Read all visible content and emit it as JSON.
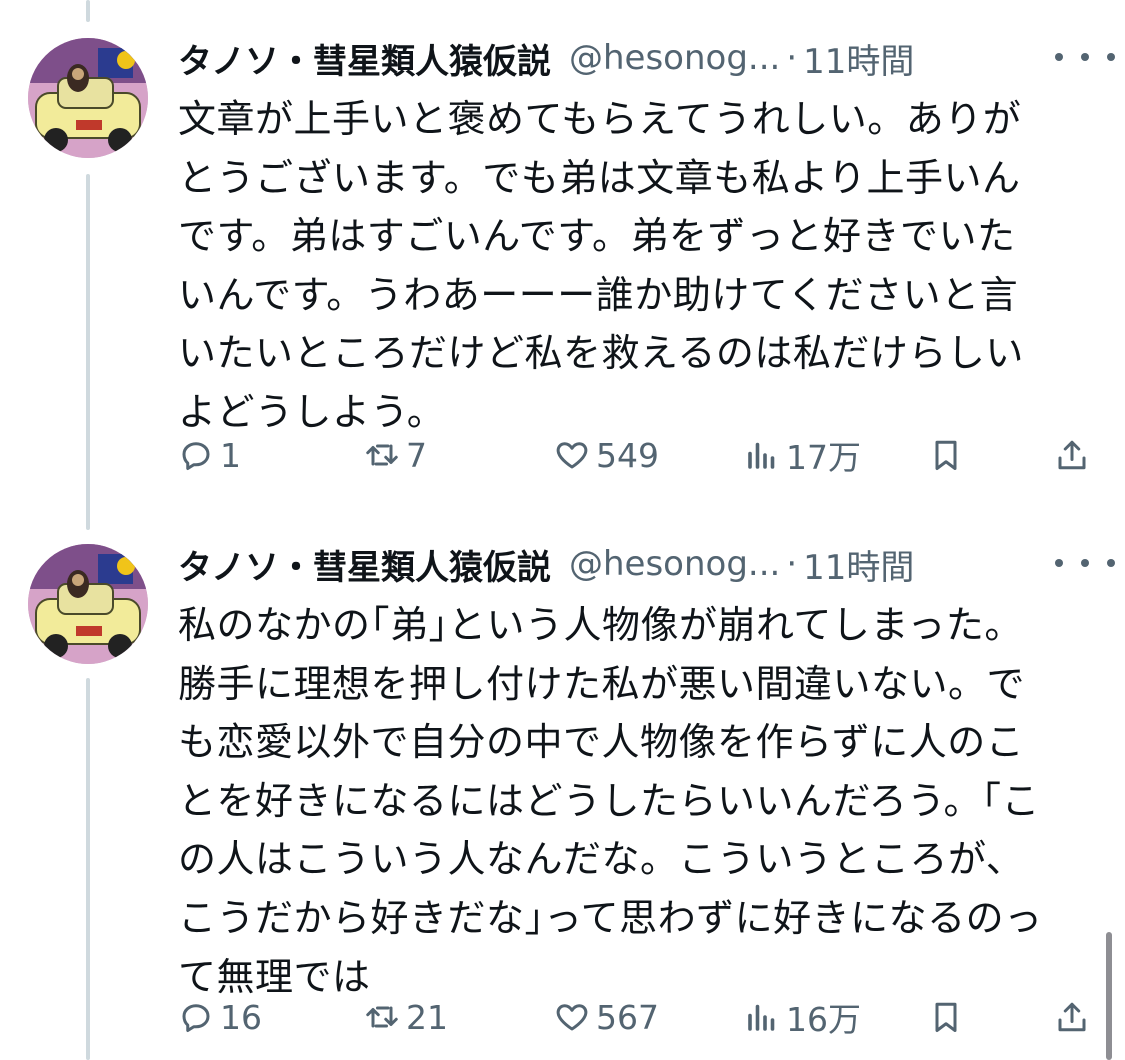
{
  "tweets": [
    {
      "name": "タノソ・彗星類人猿仮説",
      "handle": "@hesonog...",
      "separator": "·",
      "time": "11時間",
      "text": "文章が上手いと褒めてもらえてうれしい。ありが\nとうございます。でも弟は文章も私より上手いん\nです。弟はすごいんです。弟をずっと好きでいた\nいんです。うわあーーー誰か助けてくださいと言\nいたいところだけど私を救えるのは私だけらしい\nよどうしよう。",
      "replies": "1",
      "retweets": "7",
      "likes": "549",
      "views": "17万"
    },
    {
      "name": "タノソ・彗星類人猿仮説",
      "handle": "@hesonog...",
      "separator": "·",
      "time": "11時間",
      "text": "私のなかの｢弟｣という人物像が崩れてしまった。\n勝手に理想を押し付けた私が悪い間違いない。で\nも恋愛以外で自分の中で人物像を作らずに人のこ\nとを好きになるにはどうしたらいいんだろう。｢こ\nの人はこういう人なんだな。こういうところが、\nこうだから好きだな｣って思わずに好きになるのっ\nて無理では",
      "replies": "16",
      "retweets": "21",
      "likes": "567",
      "views": "16万"
    }
  ],
  "icons": {
    "reply": "reply-icon",
    "retweet": "retweet-icon",
    "like": "heart-icon",
    "views": "views-chart-icon",
    "bookmark": "bookmark-icon",
    "share": "share-icon",
    "more": "more-icon"
  },
  "colors": {
    "text": "#0f1419",
    "secondary": "#536471",
    "thread": "#cfd9de"
  }
}
